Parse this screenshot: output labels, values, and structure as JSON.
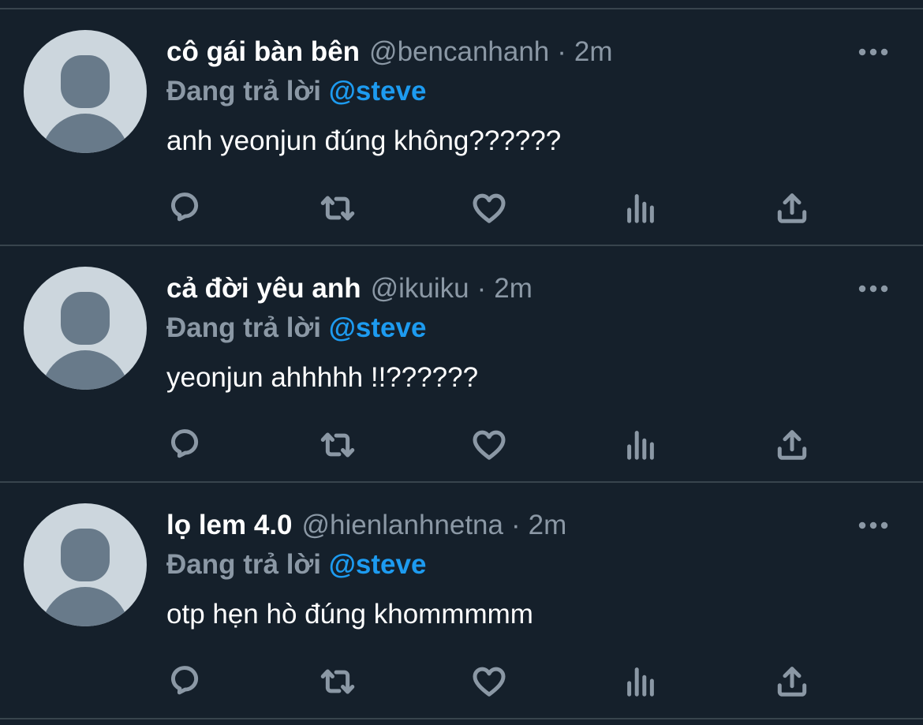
{
  "colors": {
    "background": "#15202b",
    "divider": "#38444d",
    "secondary_text": "#8b98a5",
    "accent": "#1d9bf0",
    "primary_text": "#ffffff",
    "avatar_bg": "#ccd6dd",
    "avatar_fg": "#687a8a"
  },
  "tweets": [
    {
      "name": "cô gái bàn bên",
      "handle": "@bencanhanh",
      "dot": "·",
      "time": "2m",
      "replying_prefix": "Đang trả lời",
      "replying_to": "@steve",
      "text": "anh yeonjun đúng không??????",
      "icons": {
        "avatar": "default-avatar-icon",
        "more": "more-options-icon",
        "reply": "reply-icon",
        "retweet": "retweet-icon",
        "like": "like-icon",
        "stats": "analytics-icon",
        "share": "share-icon"
      }
    },
    {
      "name": "cả đời yêu anh",
      "handle": "@ikuiku",
      "dot": "·",
      "time": "2m",
      "replying_prefix": "Đang trả lời",
      "replying_to": "@steve",
      "text": "yeonjun ahhhhh !!??????",
      "icons": {
        "avatar": "default-avatar-icon",
        "more": "more-options-icon",
        "reply": "reply-icon",
        "retweet": "retweet-icon",
        "like": "like-icon",
        "stats": "analytics-icon",
        "share": "share-icon"
      }
    },
    {
      "name": "lọ lem 4.0",
      "handle": "@hienlanhnetna",
      "dot": "·",
      "time": "2m",
      "replying_prefix": "Đang trả lời",
      "replying_to": "@steve",
      "text": "otp hẹn hò đúng khommmmm",
      "icons": {
        "avatar": "default-avatar-icon",
        "more": "more-options-icon",
        "reply": "reply-icon",
        "retweet": "retweet-icon",
        "like": "like-icon",
        "stats": "analytics-icon",
        "share": "share-icon"
      }
    }
  ]
}
